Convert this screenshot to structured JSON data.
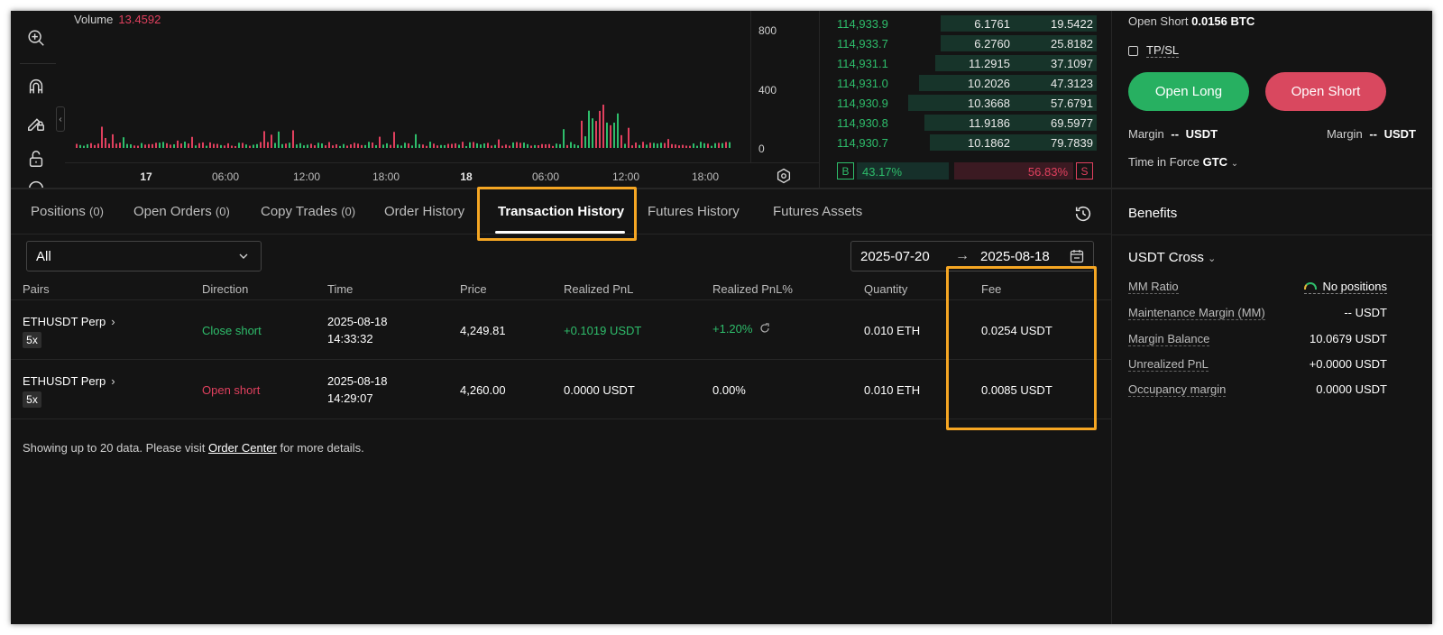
{
  "chart": {
    "volume_label": "Volume",
    "volume_value": "13.4592",
    "y_ticks": [
      "800",
      "400",
      "0"
    ],
    "x_ticks": [
      {
        "label": "17",
        "bold": true
      },
      {
        "label": "06:00",
        "bold": false
      },
      {
        "label": "12:00",
        "bold": false
      },
      {
        "label": "18:00",
        "bold": false
      },
      {
        "label": "18",
        "bold": true
      },
      {
        "label": "06:00",
        "bold": false
      },
      {
        "label": "12:00",
        "bold": false
      },
      {
        "label": "18:00",
        "bold": false
      }
    ],
    "colors": {
      "up": "#2ebd6b",
      "down": "#e0405e"
    }
  },
  "order_book": {
    "rows": [
      {
        "price": "114,933.9",
        "amount": "6.1761",
        "total": "19.5422",
        "depth": 0.58
      },
      {
        "price": "114,933.7",
        "amount": "6.2760",
        "total": "25.8182",
        "depth": 0.58
      },
      {
        "price": "114,931.1",
        "amount": "11.2915",
        "total": "37.1097",
        "depth": 0.6
      },
      {
        "price": "114,931.0",
        "amount": "10.2026",
        "total": "47.3123",
        "depth": 0.66
      },
      {
        "price": "114,930.9",
        "amount": "10.3668",
        "total": "57.6791",
        "depth": 0.7
      },
      {
        "price": "114,930.8",
        "amount": "11.9186",
        "total": "69.5977",
        "depth": 0.64
      },
      {
        "price": "114,930.7",
        "amount": "10.1862",
        "total": "79.7839",
        "depth": 0.62
      }
    ],
    "buy_badge": "B",
    "buy_pct": "43.17%",
    "sell_pct": "56.83%",
    "sell_badge": "S"
  },
  "trade_panel": {
    "open_short_label": "Open Short",
    "open_short_value": "0.0156 BTC",
    "tpsl_label": "TP/SL",
    "open_long_button": "Open Long",
    "open_short_button": "Open Short",
    "margin_left_label": "Margin",
    "margin_left_value": "--",
    "margin_left_unit": "USDT",
    "margin_right_label": "Margin",
    "margin_right_value": "--",
    "margin_right_unit": "USDT",
    "tif_label": "Time in Force",
    "tif_value": "GTC"
  },
  "account": {
    "benefits_title": "Benefits",
    "mode": "USDT Cross",
    "rows": [
      {
        "label": "MM Ratio",
        "value": "No positions"
      },
      {
        "label": "Maintenance Margin (MM)",
        "value": "-- USDT"
      },
      {
        "label": "Margin Balance",
        "value": "10.0679 USDT"
      },
      {
        "label": "Unrealized PnL",
        "value": "+0.0000 USDT"
      },
      {
        "label": "Occupancy margin",
        "value": "0.0000 USDT"
      }
    ]
  },
  "tabs": [
    {
      "label": "Positions",
      "count": "(0)"
    },
    {
      "label": "Open Orders",
      "count": "(0)"
    },
    {
      "label": "Copy Trades",
      "count": "(0)"
    },
    {
      "label": "Order History",
      "count": ""
    },
    {
      "label": "Transaction History",
      "count": "",
      "active": true
    },
    {
      "label": "Futures History",
      "count": ""
    },
    {
      "label": "Futures Assets",
      "count": ""
    }
  ],
  "filters": {
    "type_value": "All",
    "date_from": "2025-07-20",
    "date_arrow": "→",
    "date_to": "2025-08-18"
  },
  "table": {
    "headers": [
      "Pairs",
      "Direction",
      "Time",
      "Price",
      "Realized PnL",
      "Realized PnL%",
      "Quantity",
      "Fee"
    ],
    "rows": [
      {
        "pair": "ETHUSDT Perp",
        "leverage": "5x",
        "direction": "Close short",
        "direction_type": "close",
        "date": "2025-08-18",
        "time": "14:33:32",
        "price": "4,249.81",
        "pnl": "+0.1019 USDT",
        "pnl_pct": "+1.20%",
        "quantity": "0.010 ETH",
        "fee": "0.0254 USDT"
      },
      {
        "pair": "ETHUSDT Perp",
        "leverage": "5x",
        "direction": "Open short",
        "direction_type": "open",
        "date": "2025-08-18",
        "time": "14:29:07",
        "price": "4,260.00",
        "pnl": "0.0000 USDT",
        "pnl_pct": "0.00%",
        "quantity": "0.010 ETH",
        "fee": "0.0085 USDT"
      }
    ]
  },
  "footnote": {
    "prefix": "Showing up to 20 data. Please visit",
    "link": "Order Center",
    "suffix": "for more details."
  }
}
